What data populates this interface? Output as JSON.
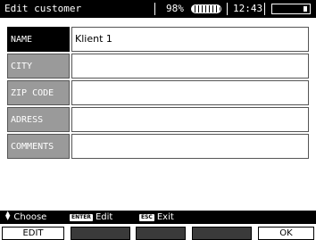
{
  "header": {
    "title": "Edit customer",
    "battery_percent": "98%",
    "time": "12:43"
  },
  "form": {
    "fields": [
      {
        "label": "NAME",
        "value": "Klient 1"
      },
      {
        "label": "CITY",
        "value": ""
      },
      {
        "label": "ZIP CODE",
        "value": ""
      },
      {
        "label": "ADRESS",
        "value": ""
      },
      {
        "label": "COMMENTS",
        "value": ""
      }
    ]
  },
  "hints": {
    "choose": "Choose",
    "enter_key": "ENTER",
    "edit": "Edit",
    "esc_key": "ESC",
    "exit": "Exit"
  },
  "softkeys": {
    "edit": "EDIT",
    "ok": "OK"
  },
  "icons": {
    "battery": "battery-icon",
    "memory": "memory-card-icon",
    "updown": "up-down-arrow-icon"
  }
}
